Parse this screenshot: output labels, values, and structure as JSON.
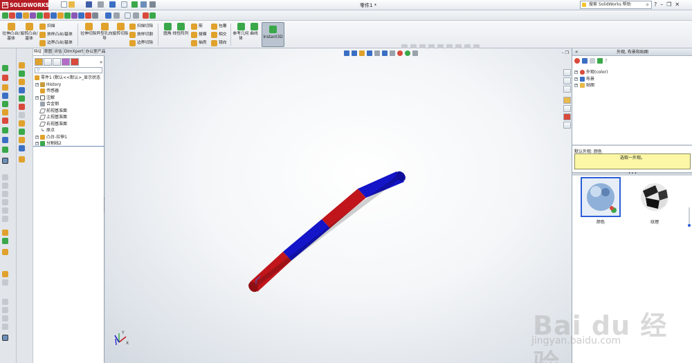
{
  "app": {
    "logo_text": "SOLIDWORKS",
    "document_title": "零件1 *",
    "search_placeholder": "搜索 SolidWorks 帮助"
  },
  "ribbon": {
    "extrude_boss": "拉伸凸台/基体",
    "revolve_boss": "旋转凸台/基体",
    "sweep": "扫描",
    "loft_boss": "放样凸台/基体",
    "boundary_boss": "边界凸台/基体",
    "extruded_cut": "拉伸切除",
    "hole_wizard": "异型孔向导",
    "revolved_cut": "旋转切除",
    "swept_cut": "扫描切除",
    "lofted_cut": "放样切割",
    "boundary_cut": "边界切除",
    "fillet": "圆角",
    "linear_pattern": "线性阵列",
    "rib": "筋",
    "draft": "拔模",
    "shell": "抽壳",
    "wrap": "包覆",
    "intersect": "相交",
    "mirror": "镜向",
    "reference_geometry": "参考几何体",
    "curves": "曲线",
    "instant3d": "Instant3D"
  },
  "feature_manager": {
    "tabs": [
      "特征",
      "草图",
      "评估",
      "DimXpert",
      "办公室产品"
    ],
    "filter_glyph": "▽",
    "part_root": "零件1  (默认<<默认>_显示状态",
    "history": "History",
    "sensors": "传感器",
    "annotations": "注解",
    "material": "合金钢",
    "front_plane": "前视基准面",
    "top_plane": "上视基准面",
    "right_plane": "右视基准面",
    "origin": "原点",
    "boss_extrude": "凸台-拉伸1",
    "split_line": "分割线2"
  },
  "task_pane": {
    "title": "外观, 布景和贴图",
    "tree": [
      "外观(color)",
      "布景",
      "贴图"
    ],
    "default_appearance_label": "默认外观: 颜色",
    "message": "选取一外观。",
    "swatches": [
      "颜色",
      "纹理"
    ]
  },
  "watermark": {
    "line1": "Bai du 经验",
    "line2": "jingyan.baidu.com"
  },
  "colors": {
    "accent_red": "#b41d25",
    "cylinder_red": "#c0161b",
    "cylinder_blue": "#1414c8",
    "selection_blue": "#2b5fd8",
    "message_yellow": "#fbf7a6"
  }
}
